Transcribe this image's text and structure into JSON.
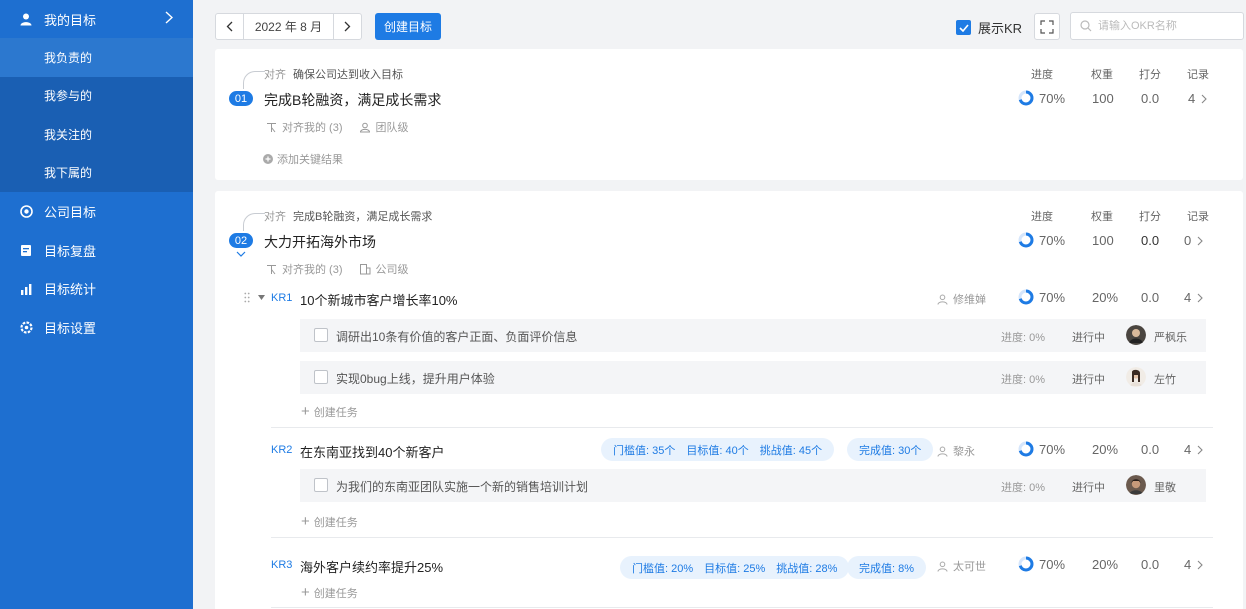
{
  "sidebar": {
    "my_goals": "我的目标",
    "sub_items": [
      "我负责的",
      "我参与的",
      "我关注的",
      "我下属的"
    ],
    "items": [
      {
        "label": "公司目标",
        "icon": "target-icon"
      },
      {
        "label": "目标复盘",
        "icon": "review-icon"
      },
      {
        "label": "目标统计",
        "icon": "stats-icon"
      },
      {
        "label": "目标设置",
        "icon": "settings-icon"
      }
    ]
  },
  "toolbar": {
    "date": "2022 年 8 月",
    "create_label": "创建目标",
    "show_kr_label": "展示KR",
    "search_placeholder": "请输入OKR名称"
  },
  "columns": {
    "progress": "进度",
    "weight": "权重",
    "score": "打分",
    "records": "记录"
  },
  "objectives": [
    {
      "num": "01",
      "align_label": "对齐",
      "align_text": "确保公司达到收入目标",
      "title": "完成B轮融资，满足成长需求",
      "aligned_to_me": "对齐我的 (3)",
      "level": "团队级",
      "progress": "70%",
      "weight": "100",
      "score": "0.0",
      "records": "4",
      "add_kr": "添加关键结果"
    },
    {
      "num": "02",
      "align_label": "对齐",
      "align_text": "完成B轮融资，满足成长需求",
      "title": "大力开拓海外市场",
      "aligned_to_me": "对齐我的 (3)",
      "level": "公司级",
      "progress": "70%",
      "weight": "100",
      "score": "0.0",
      "records": "0",
      "krs": [
        {
          "code": "KR1",
          "title": "10个新城市客户增长率10%",
          "owner": "修维婵",
          "progress": "70%",
          "weight": "20%",
          "score": "0.0",
          "records": "4",
          "tasks": [
            {
              "title": "调研出10条有价值的客户正面、负面评价信息",
              "progress": "进度: 0%",
              "status": "进行中",
              "assignee": "严枫乐"
            },
            {
              "title": "实现0bug上线，提升用户体验",
              "progress": "进度: 0%",
              "status": "进行中",
              "assignee": "左竹"
            }
          ],
          "create_task": "创建任务"
        },
        {
          "code": "KR2",
          "title": "在东南亚找到40个新客户",
          "threshold": "门槛值: 35个",
          "target": "目标值: 40个",
          "challenge": "挑战值: 45个",
          "done": "完成值: 30个",
          "owner": "黎永",
          "progress": "70%",
          "weight": "20%",
          "score": "0.0",
          "records": "4",
          "tasks": [
            {
              "title": "为我们的东南亚团队实施一个新的销售培训计划",
              "progress": "进度: 0%",
              "status": "进行中",
              "assignee": "里敬"
            }
          ],
          "create_task": "创建任务"
        },
        {
          "code": "KR3",
          "title": "海外客户续约率提升25%",
          "threshold": "门槛值: 20%",
          "target": "目标值: 25%",
          "challenge": "挑战值: 28%",
          "done": "完成值: 8%",
          "owner": "太可世",
          "progress": "70%",
          "weight": "20%",
          "score": "0.0",
          "records": "4",
          "create_task": "创建任务"
        }
      ]
    }
  ],
  "colors": {
    "sidebar": "#1e6fd0",
    "accent": "#1e7be4",
    "pill_bg": "#e8f2fd"
  }
}
